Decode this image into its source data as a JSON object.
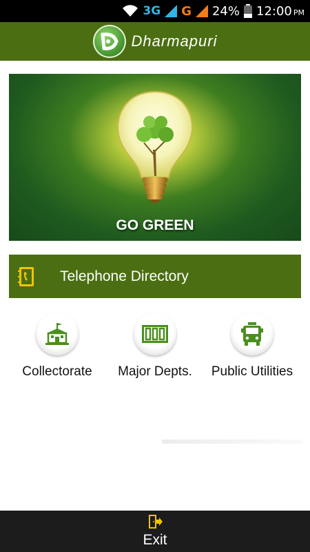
{
  "status_bar": {
    "network_label": "3G",
    "network_g": "G",
    "battery": "24%",
    "time": "12:00",
    "ampm": "PM"
  },
  "header": {
    "title": "Dharmapuri",
    "logo_icon": "dharmapuri-logo-icon"
  },
  "banner": {
    "text": "GO GREEN",
    "image": "lightbulb-tree-icon"
  },
  "directory": {
    "label": "Telephone Directory",
    "icon": "phonebook-icon"
  },
  "categories": [
    {
      "label": "Collectorate",
      "icon": "building-icon"
    },
    {
      "label": "Major Depts.",
      "icon": "cabinets-icon"
    },
    {
      "label": "Public Utilities",
      "icon": "bus-icon"
    }
  ],
  "bottom": {
    "exit_label": "Exit",
    "exit_icon": "exit-door-icon"
  },
  "colors": {
    "brand_green": "#4b6e12",
    "icon_green": "#4a8f1e",
    "bottom_bar": "#1c1c1c"
  }
}
